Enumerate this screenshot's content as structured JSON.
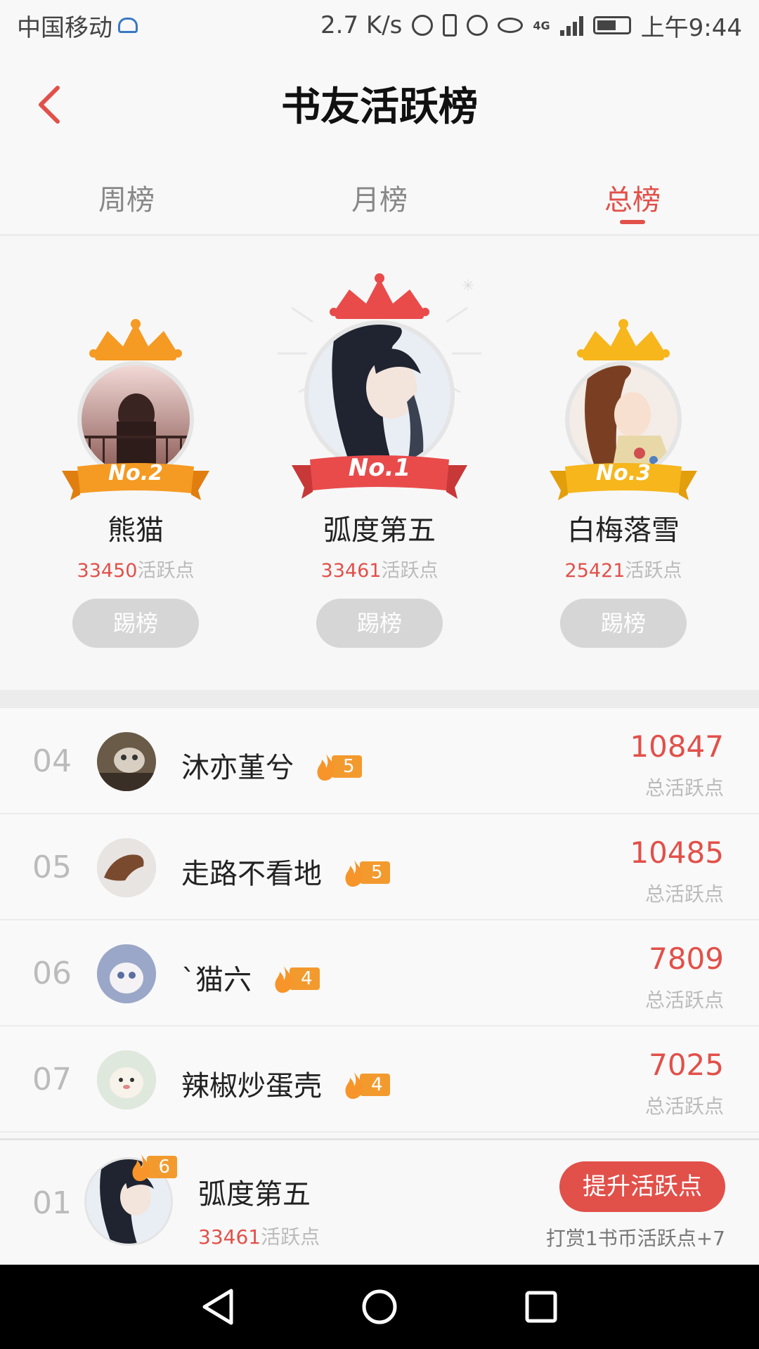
{
  "status_bar": {
    "carrier": "中国移动",
    "net_speed": "2.7 K/s",
    "network": "4G",
    "time": "上午9:44"
  },
  "header": {
    "title": "书友活跃榜"
  },
  "tabs": [
    {
      "label": "周榜",
      "active": false
    },
    {
      "label": "月榜",
      "active": false
    },
    {
      "label": "总榜",
      "active": true
    }
  ],
  "podium": {
    "second": {
      "rank_label": "No.2",
      "name": "熊猫",
      "points": "33450",
      "points_unit": "活跃点",
      "button": "踢榜",
      "color": "#f59a22"
    },
    "first": {
      "rank_label": "No.1",
      "name": "弧度第五",
      "points": "33461",
      "points_unit": "活跃点",
      "button": "踢榜",
      "color": "#e94b4b"
    },
    "third": {
      "rank_label": "No.3",
      "name": "白梅落雪",
      "points": "25421",
      "points_unit": "活跃点",
      "button": "踢榜",
      "color": "#f6b61c"
    }
  },
  "list": [
    {
      "rank": "04",
      "name": "沐亦堇兮",
      "level": "5",
      "score": "10847",
      "score_label": "总活跃点"
    },
    {
      "rank": "05",
      "name": "走路不看地",
      "level": "5",
      "score": "10485",
      "score_label": "总活跃点"
    },
    {
      "rank": "06",
      "name": "`猫六",
      "level": "4",
      "score": "7809",
      "score_label": "总活跃点"
    },
    {
      "rank": "07",
      "name": "辣椒炒蛋壳",
      "level": "4",
      "score": "7025",
      "score_label": "总活跃点"
    }
  ],
  "my_rank": {
    "rank": "01",
    "name": "弧度第五",
    "level": "6",
    "points": "33461",
    "points_unit": "活跃点",
    "button": "提升活跃点",
    "note": "打赏1书币活跃点+7"
  },
  "colors": {
    "accent": "#e2504a",
    "gold": "#f6b61c",
    "orange": "#f59a22"
  }
}
